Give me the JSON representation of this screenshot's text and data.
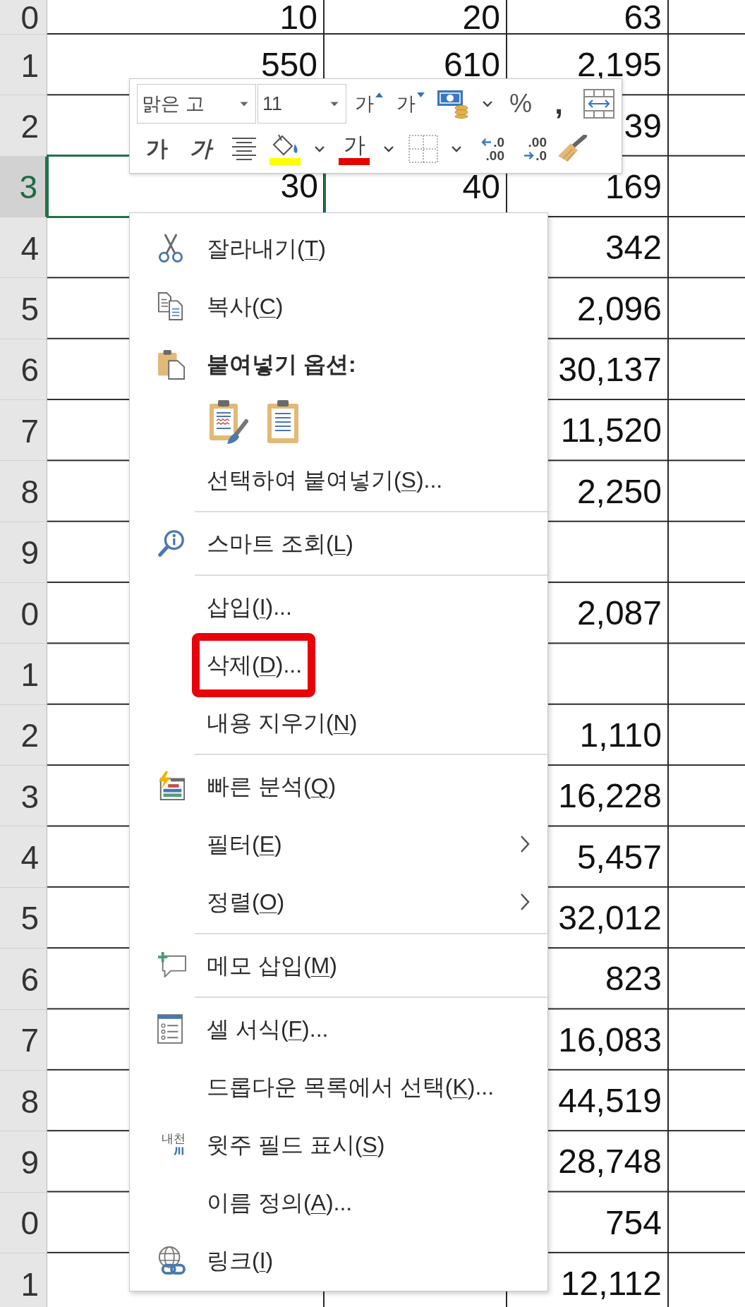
{
  "sheet": {
    "rows": [
      {
        "header": "0",
        "selected": false,
        "column_1": "10",
        "column_2": "20",
        "column_3": "63"
      },
      {
        "header": "1",
        "selected": false,
        "column_1": "550",
        "column_2": "610",
        "column_3": "2,195"
      },
      {
        "header": "2",
        "selected": false,
        "column_3": "39"
      },
      {
        "header": "3",
        "selected": true,
        "column_1": "30",
        "column_2": "40",
        "column_3": "169"
      },
      {
        "header": "4",
        "selected": false,
        "column_3": "342"
      },
      {
        "header": "5",
        "selected": false,
        "column_3": "2,096"
      },
      {
        "header": "6",
        "selected": false,
        "column_3": "30,137"
      },
      {
        "header": "7",
        "selected": false,
        "column_3": "11,520"
      },
      {
        "header": "8",
        "selected": false,
        "column_3": "2,250"
      },
      {
        "header": "9",
        "selected": false
      },
      {
        "header": "0",
        "selected": false,
        "column_3": "2,087"
      },
      {
        "header": "1",
        "selected": false
      },
      {
        "header": "2",
        "selected": false,
        "column_3": "1,110"
      },
      {
        "header": "3",
        "selected": false,
        "column_3": "16,228"
      },
      {
        "header": "4",
        "selected": false,
        "column_3": "5,457"
      },
      {
        "header": "5",
        "selected": false,
        "column_3": "32,012"
      },
      {
        "header": "6",
        "selected": false,
        "column_3": "823"
      },
      {
        "header": "7",
        "selected": false,
        "column_3": "16,083"
      },
      {
        "header": "8",
        "selected": false,
        "column_3": "44,519"
      },
      {
        "header": "9",
        "selected": false,
        "column_3": "28,748"
      },
      {
        "header": "0",
        "selected": false,
        "column_3": "754"
      },
      {
        "header": "1",
        "selected": false,
        "column_3": "12,112"
      }
    ]
  },
  "mini_toolbar": {
    "rows": [
      [
        {
          "kind": "font",
          "value": "맑은 고",
          "dropdown": true
        },
        {
          "kind": "size",
          "value": "11",
          "dropdown": true
        },
        {
          "kind": "grow",
          "text": "가"
        },
        {
          "kind": "shrink",
          "text": "가"
        },
        {
          "kind": "accounting",
          "dropdown": true
        },
        {
          "kind": "percent",
          "text": "%"
        },
        {
          "kind": "comma",
          "text": ","
        },
        {
          "kind": "autofit"
        }
      ],
      [
        {
          "kind": "bold",
          "text": "가"
        },
        {
          "kind": "italic",
          "text": "가"
        },
        {
          "kind": "center"
        },
        {
          "kind": "fill",
          "color": "#ffff00",
          "dropdown": true
        },
        {
          "kind": "fontcolor",
          "text": "가",
          "color": "#e60000",
          "dropdown": true
        },
        {
          "kind": "borders",
          "dropdown": true
        },
        {
          "kind": "adddecimal",
          "top": ".0",
          "bottom": ".00"
        },
        {
          "kind": "cutdecimal",
          "top": ".00",
          "bottom": ".0"
        },
        {
          "kind": "painter"
        }
      ]
    ]
  },
  "context_menu": {
    "items": [
      {
        "kind": "cut",
        "label_start": "잘라내기(",
        "access_key": "T",
        "label_end": ")",
        "highlighted": false,
        "submenu": false
      },
      {
        "kind": "copy",
        "label_start": "복사(",
        "access_key": "C",
        "label_end": ")",
        "highlighted": false,
        "submenu": false
      },
      {
        "kind": "heading",
        "text": "붙여넣기 옵션:"
      },
      {
        "kind": "options",
        "options": [
          {
            "kind": "formatting"
          },
          {
            "kind": "plain"
          }
        ]
      },
      {
        "kind": "plain",
        "label_start": "선택하여 붙여넣기(",
        "access_key": "S",
        "label_end": ")...",
        "highlighted": false,
        "submenu": false
      },
      {
        "kind": "separator"
      },
      {
        "kind": "lookup",
        "label_start": "스마트 조회(",
        "access_key": "L",
        "label_end": ")",
        "highlighted": false,
        "submenu": false
      },
      {
        "kind": "separator"
      },
      {
        "kind": "plain",
        "label_start": "삽입(",
        "access_key": "I",
        "label_end": ")...",
        "highlighted": false,
        "submenu": false
      },
      {
        "kind": "plain",
        "label_start": "삭제(",
        "access_key": "D",
        "label_end": ")...",
        "highlighted": true,
        "submenu": false
      },
      {
        "kind": "plain",
        "label_start": "내용 지우기(",
        "access_key": "N",
        "label_end": ")",
        "highlighted": false,
        "submenu": false
      },
      {
        "kind": "separator"
      },
      {
        "kind": "analysis",
        "label_start": "빠른 분석(",
        "access_key": "Q",
        "label_end": ")",
        "highlighted": false,
        "submenu": false
      },
      {
        "kind": "plain",
        "label_start": "필터(",
        "access_key": "E",
        "label_end": ")",
        "highlighted": false,
        "submenu": true
      },
      {
        "kind": "plain",
        "label_start": "정렬(",
        "access_key": "O",
        "label_end": ")",
        "highlighted": false,
        "submenu": true
      },
      {
        "kind": "separator"
      },
      {
        "kind": "comment",
        "label_start": "메모 삽입(",
        "access_key": "M",
        "label_end": ")",
        "highlighted": false,
        "submenu": false
      },
      {
        "kind": "separator"
      },
      {
        "kind": "format",
        "label_start": "셀 서식(",
        "access_key": "F",
        "label_end": ")...",
        "highlighted": false,
        "submenu": false
      },
      {
        "kind": "plain",
        "label_start": "드롭다운 목록에서 선택(",
        "access_key": "K",
        "label_end": ")...",
        "highlighted": false,
        "submenu": false
      },
      {
        "kind": "phonetic",
        "icon_text": "내천",
        "label_start": "윗주 필드 표시(",
        "access_key": "S",
        "label_end": ")",
        "highlighted": false,
        "submenu": false
      },
      {
        "kind": "plain",
        "label_start": "이름 정의(",
        "access_key": "A",
        "label_end": ")...",
        "highlighted": false,
        "submenu": false
      },
      {
        "kind": "link",
        "label_start": "링크(",
        "access_key": "I",
        "label_end": ")",
        "highlighted": false,
        "submenu": false
      }
    ]
  }
}
